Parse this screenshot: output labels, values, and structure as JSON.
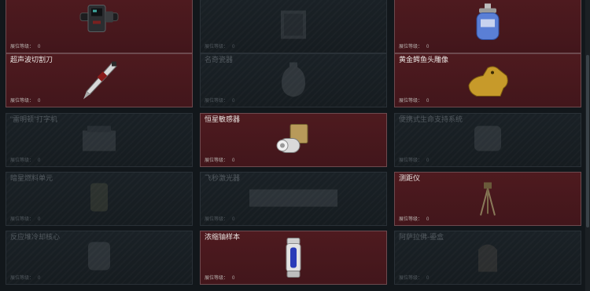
{
  "level_label": "展位等级：",
  "cards": [
    {
      "name": "",
      "level": "0",
      "active": true,
      "icon": "device-belt-icon"
    },
    {
      "name": "",
      "level": "0",
      "active": false,
      "icon": "crate-icon"
    },
    {
      "name": "",
      "level": "0",
      "active": true,
      "icon": "gas-canister-icon"
    },
    {
      "name": "超声波切割刀",
      "level": "0",
      "active": true,
      "icon": "ultrasonic-knife-icon"
    },
    {
      "name": "名奇瓷器",
      "level": "0",
      "active": false,
      "icon": "porcelain-vase-icon"
    },
    {
      "name": "黄金鳄鱼头雕像",
      "level": "0",
      "active": true,
      "icon": "golden-crocodile-statue-icon"
    },
    {
      "name": "“雷明顿”打字机",
      "level": "0",
      "active": false,
      "icon": "typewriter-icon"
    },
    {
      "name": "恒星敏感器",
      "level": "0",
      "active": true,
      "icon": "star-sensor-icon"
    },
    {
      "name": "便携式生命支持系统",
      "level": "0",
      "active": false,
      "icon": "life-support-icon"
    },
    {
      "name": "暗星燃料单元",
      "level": "0",
      "active": false,
      "icon": "fuel-cell-icon"
    },
    {
      "name": "飞秒激光器",
      "level": "0",
      "active": false,
      "icon": "laser-icon"
    },
    {
      "name": "测距仪",
      "level": "0",
      "active": true,
      "icon": "rangefinder-icon"
    },
    {
      "name": "反应堆冷却核心",
      "level": "0",
      "active": false,
      "icon": "reactor-core-icon"
    },
    {
      "name": "浓缩铀样本",
      "level": "0",
      "active": true,
      "icon": "uranium-sample-icon"
    },
    {
      "name": "阿萨拉佛-鎏盒",
      "level": "0",
      "active": false,
      "icon": "ornate-box-icon"
    }
  ]
}
